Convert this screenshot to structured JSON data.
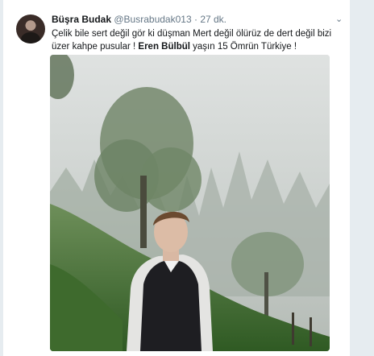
{
  "tweet": {
    "author_name": "Büşra Budak",
    "author_handle": "@Busrabudak013",
    "separator": "·",
    "timestamp": "27 dk.",
    "text_before": "Çelik bile sert değil gör ki düşman Mert değil ölürüz de dert değil bizi üzer kahpe pusular ! ",
    "mention": "Eren Bülbül",
    "text_after": " yaşın 15 Ömrün Türkiye !"
  },
  "icons": {
    "menu": "chevron-down-icon",
    "avatar": "avatar"
  },
  "colors": {
    "background": "#e6ecf0",
    "card": "#ffffff",
    "text": "#14171a",
    "muted": "#657786"
  }
}
